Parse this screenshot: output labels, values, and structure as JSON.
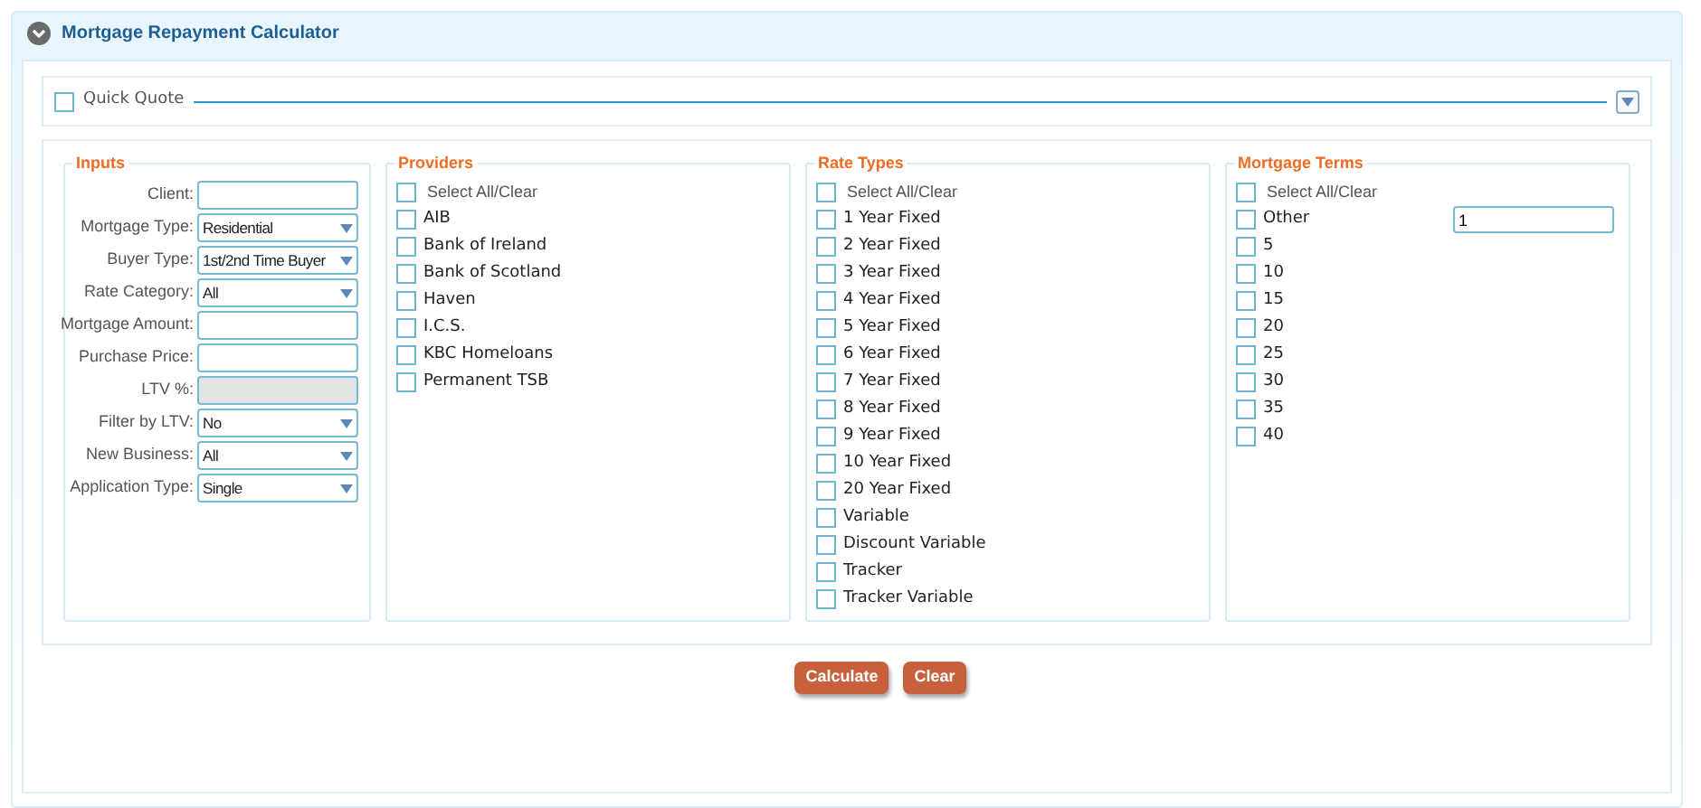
{
  "title": "Mortgage Repayment Calculator",
  "quick_quote": {
    "label": "Quick Quote",
    "checked": false,
    "expanded": false
  },
  "inputs": {
    "legend": "Inputs",
    "fields": [
      {
        "label": "Client:",
        "kind": "text"
      },
      {
        "label": "Mortgage Type:",
        "kind": "select",
        "value": "Residential"
      },
      {
        "label": "Buyer Type:",
        "kind": "select",
        "value": "1st/2nd Time Buyer"
      },
      {
        "label": "Rate Category:",
        "kind": "select",
        "value": "All"
      },
      {
        "label": "Mortgage Amount:",
        "kind": "text"
      },
      {
        "label": "Purchase Price:",
        "kind": "text"
      },
      {
        "label": "LTV %:",
        "kind": "disabled"
      },
      {
        "label": "Filter by LTV:",
        "kind": "select",
        "value": "No"
      },
      {
        "label": "New Business:",
        "kind": "select",
        "value": "All"
      },
      {
        "label": "Application Type:",
        "kind": "select",
        "value": "Single"
      }
    ]
  },
  "groups": [
    {
      "legend": "Providers",
      "select_all": {
        "label": "Select All/Clear",
        "checked": false
      },
      "items": [
        {
          "label": "AIB",
          "checked": false
        },
        {
          "label": "Bank of Ireland",
          "checked": false
        },
        {
          "label": "Bank of Scotland",
          "checked": false
        },
        {
          "label": "Haven",
          "checked": false
        },
        {
          "label": "I.C.S.",
          "checked": false
        },
        {
          "label": "KBC Homeloans",
          "checked": false
        },
        {
          "label": "Permanent TSB",
          "checked": false
        }
      ]
    },
    {
      "legend": "Rate Types",
      "select_all": {
        "label": "Select All/Clear",
        "checked": false
      },
      "items": [
        {
          "label": "1 Year Fixed",
          "checked": false
        },
        {
          "label": "2 Year Fixed",
          "checked": false
        },
        {
          "label": "3 Year Fixed",
          "checked": false
        },
        {
          "label": "4 Year Fixed",
          "checked": false
        },
        {
          "label": "5 Year Fixed",
          "checked": false
        },
        {
          "label": "6 Year Fixed",
          "checked": false
        },
        {
          "label": "7 Year Fixed",
          "checked": false
        },
        {
          "label": "8 Year Fixed",
          "checked": false
        },
        {
          "label": "9 Year Fixed",
          "checked": false
        },
        {
          "label": "10 Year Fixed",
          "checked": false
        },
        {
          "label": "20 Year Fixed",
          "checked": false
        },
        {
          "label": "Variable",
          "checked": false
        },
        {
          "label": "Discount Variable",
          "checked": false
        },
        {
          "label": "Tracker",
          "checked": false
        },
        {
          "label": "Tracker Variable",
          "checked": false
        }
      ]
    },
    {
      "legend": "Mortgage Terms",
      "select_all": {
        "label": "Select All/Clear",
        "checked": false
      },
      "items": [
        {
          "label": "Other",
          "checked": false,
          "value": "1"
        },
        {
          "label": "5",
          "checked": false
        },
        {
          "label": "10",
          "checked": false
        },
        {
          "label": "15",
          "checked": false
        },
        {
          "label": "20",
          "checked": false
        },
        {
          "label": "25",
          "checked": false
        },
        {
          "label": "30",
          "checked": false
        },
        {
          "label": "35",
          "checked": false
        },
        {
          "label": "40",
          "checked": false
        }
      ]
    }
  ],
  "buttons": [
    "Calculate",
    "Clear"
  ]
}
